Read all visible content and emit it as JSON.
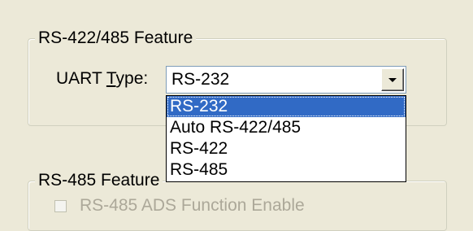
{
  "group_rs422_485": {
    "title": "RS-422/485 Feature",
    "uart_label_prefix": "UART ",
    "uart_label_accel": "T",
    "uart_label_suffix": "ype:",
    "uart_selected": "RS-232",
    "uart_options": [
      "RS-232",
      "Auto RS-422/485",
      "RS-422",
      "RS-485"
    ],
    "highlighted_index": 0
  },
  "group_rs485": {
    "title": "RS-485 Feature",
    "ads_checkbox_label": "RS-485 ADS Function Enable",
    "ads_checked": false,
    "ads_enabled": false
  },
  "colors": {
    "window_bg": "#ece9d8",
    "highlight": "#316ac5",
    "disabled_text": "#aca899"
  }
}
